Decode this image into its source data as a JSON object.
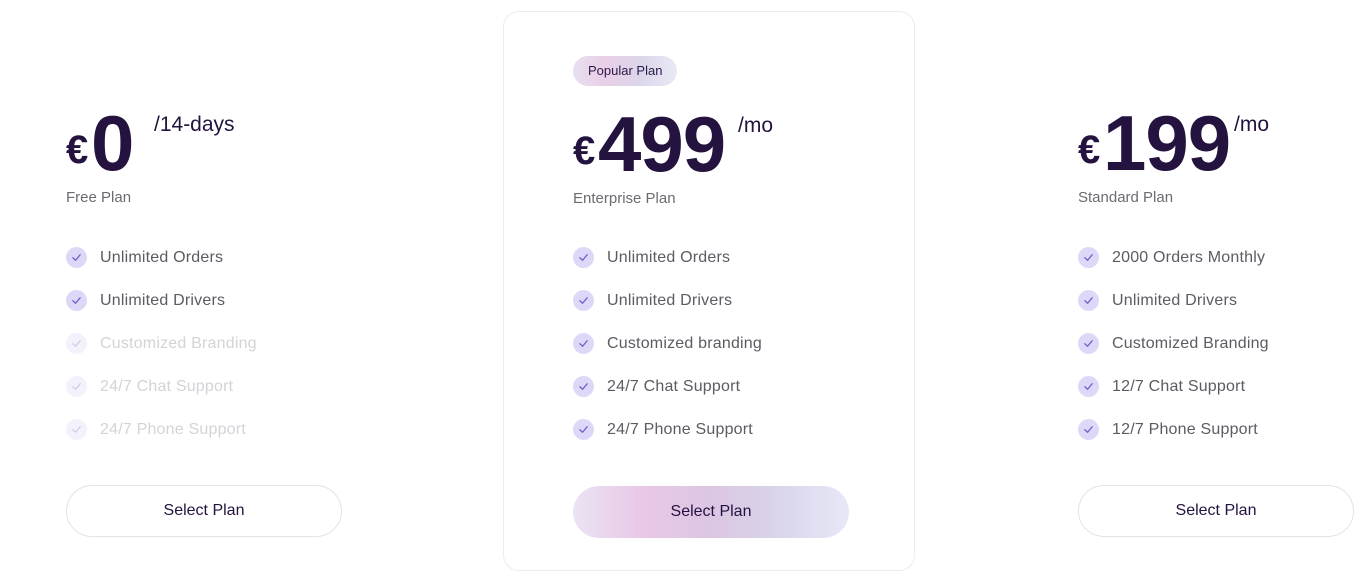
{
  "colors": {
    "primary_text": "#24123f",
    "muted_text": "#6b6b72",
    "check_bg": "#ddd8f7",
    "check_mark": "#6f5bc8"
  },
  "plans": [
    {
      "currency": "€",
      "amount": "0",
      "period": "/14-days",
      "name": "Free Plan",
      "features": [
        {
          "label": "Unlimited Orders",
          "included": true,
          "icon": "check-icon"
        },
        {
          "label": "Unlimited Drivers",
          "included": true,
          "icon": "check-icon"
        },
        {
          "label": "Customized Branding",
          "included": false,
          "icon": "check-icon"
        },
        {
          "label": "24/7 Chat Support",
          "included": false,
          "icon": "check-icon"
        },
        {
          "label": "24/7 Phone Support",
          "included": false,
          "icon": "check-icon"
        }
      ],
      "button_label": "Select Plan"
    },
    {
      "badge": "Popular Plan",
      "currency": "€",
      "amount": "499",
      "period": "/mo",
      "name": "Enterprise Plan",
      "features": [
        {
          "label": "Unlimited Orders",
          "included": true,
          "icon": "check-icon"
        },
        {
          "label": "Unlimited Drivers",
          "included": true,
          "icon": "check-icon"
        },
        {
          "label": "Customized branding",
          "included": true,
          "icon": "check-icon"
        },
        {
          "label": "24/7 Chat Support",
          "included": true,
          "icon": "check-icon"
        },
        {
          "label": "24/7 Phone Support",
          "included": true,
          "icon": "check-icon"
        }
      ],
      "button_label": "Select Plan"
    },
    {
      "currency": "€",
      "amount": "199",
      "period": "/mo",
      "name": "Standard Plan",
      "features": [
        {
          "label": "2000 Orders Monthly",
          "included": true,
          "icon": "check-icon"
        },
        {
          "label": "Unlimited Drivers",
          "included": true,
          "icon": "check-icon"
        },
        {
          "label": "Customized Branding",
          "included": true,
          "icon": "check-icon"
        },
        {
          "label": "12/7 Chat Support",
          "included": true,
          "icon": "check-icon"
        },
        {
          "label": "12/7 Phone Support",
          "included": true,
          "icon": "check-icon"
        }
      ],
      "button_label": "Select Plan"
    }
  ]
}
